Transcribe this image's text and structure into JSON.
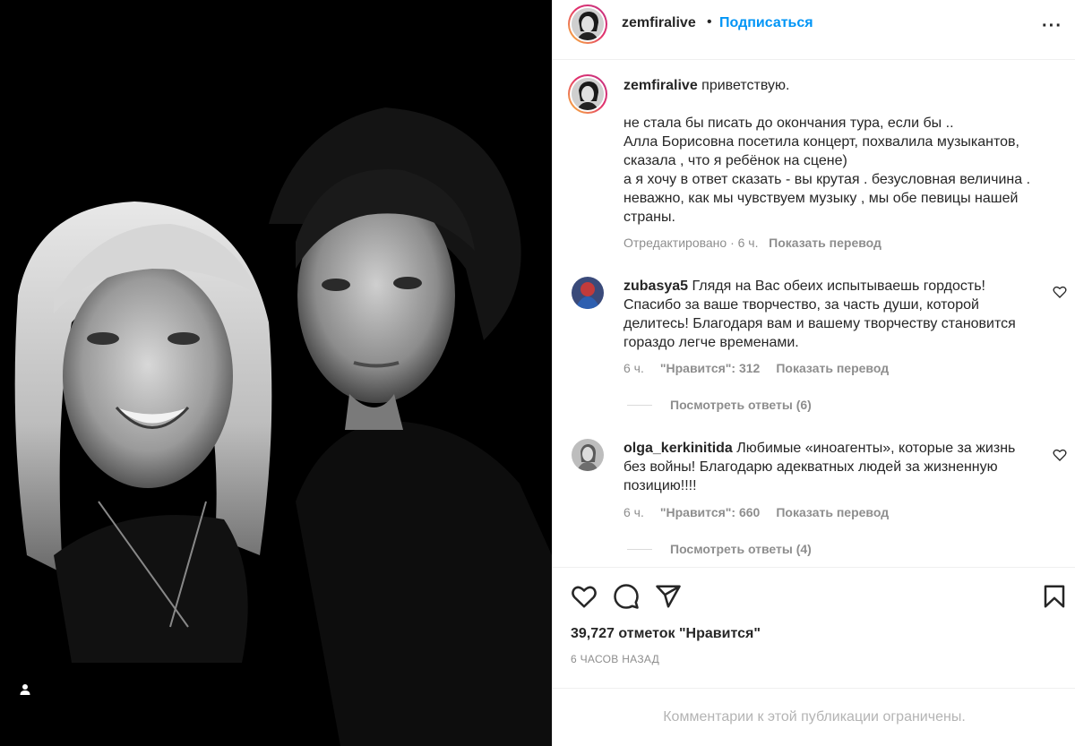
{
  "header": {
    "username": "zemfiralive",
    "separator": "•",
    "follow_label": "Подписаться",
    "more_icon": "more-icon",
    "more_label": "···"
  },
  "caption": {
    "username": "zemfiralive",
    "greeting": " приветствую.",
    "body": "не стала бы писать до окончания тура, если бы ..\nАлла Борисовна посетила концерт, похвалила музыкантов, сказала , что я ребёнок на сцене)\nа я хочу в ответ сказать - вы крутая . безусловная величина . неважно, как мы чувствуем музыку , мы обе певицы нашей страны.",
    "edited": "Отредактировано · 6 ч.",
    "translate": "Показать перевод"
  },
  "comments": [
    {
      "username": "zubasya5",
      "text": " Глядя на Вас обеих испытываешь гордость! Спасибо за ваше творчество, за часть души, которой делитесь! Благодаря вам и вашему творчеству становится гораздо легче временами.",
      "time": "6 ч.",
      "likes": "\"Нравится\": 312",
      "translate": "Показать перевод",
      "replies": "Посмотреть ответы (6)"
    },
    {
      "username": "olga_kerkinitida",
      "text": " Любимые «иноагенты», которые за жизнь без войны! Благодарю адекватных людей за жизненную позицию!!!!",
      "time": "6 ч.",
      "likes": "\"Нравится\": 660",
      "translate": "Показать перевод",
      "replies": "Посмотреть ответы (4)"
    }
  ],
  "actions": {
    "like_icon": "heart-icon",
    "comment_icon": "comment-icon",
    "share_icon": "send-icon",
    "save_icon": "bookmark-icon"
  },
  "likes_count": "39,727 отметок \"Нравится\"",
  "time_ago": "6 ЧАСОВ НАЗАД",
  "footer_text": "Комментарии к этой публикации ограничены.",
  "colors": {
    "link": "#0095f6",
    "text": "#262626",
    "muted": "#8e8e8e",
    "border": "#efefef"
  }
}
